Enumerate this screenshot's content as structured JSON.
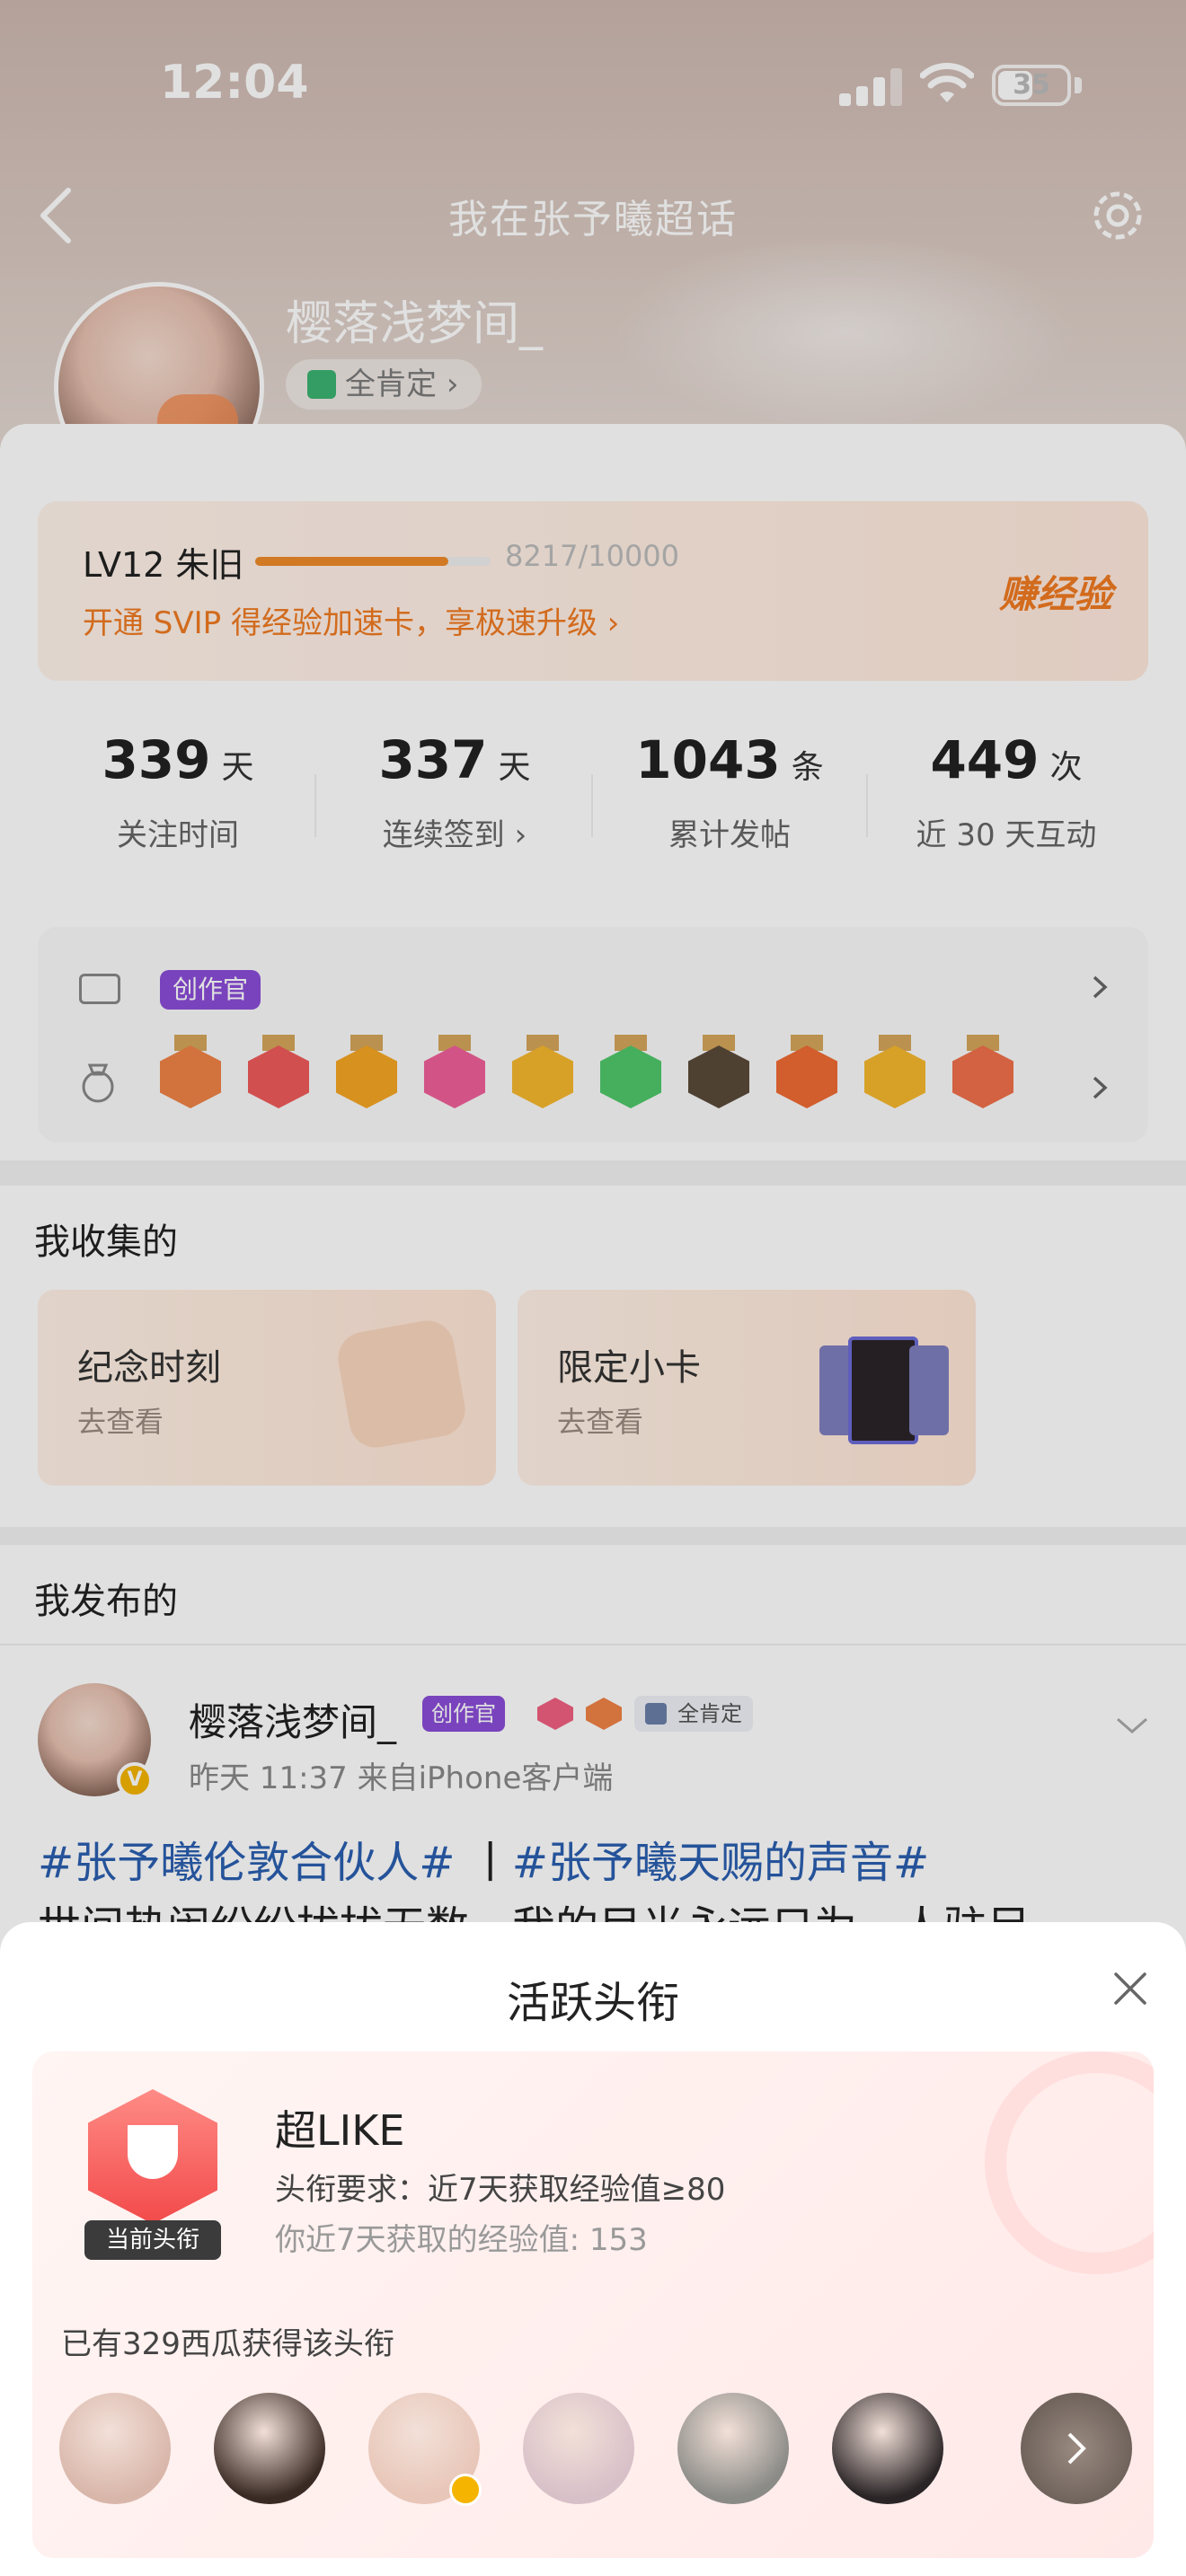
{
  "status_bar": {
    "time": "12:04",
    "battery": "35"
  },
  "nav": {
    "title": "我在张予曦超话"
  },
  "profile": {
    "username": "樱落浅梦间_",
    "approve_label": "全肯定",
    "approve_arrow": "›"
  },
  "level": {
    "name": "LV12 朱旧",
    "progress_text": "8217/10000",
    "progress_fraction": 0.8217,
    "promo": "开通 SVIP 得经验加速卡，享极速升级 ›",
    "earn_exp": "赚经验",
    "accent_color": "#f07a22"
  },
  "stats": [
    {
      "value": "339",
      "unit": "天",
      "label": "关注时间"
    },
    {
      "value": "337",
      "unit": "天",
      "label": "连续签到 ›"
    },
    {
      "value": "1043",
      "unit": "条",
      "label": "累计发帖"
    },
    {
      "value": "449",
      "unit": "次",
      "label": "近 30 天互动"
    }
  ],
  "badges": {
    "creator_label": "创作官",
    "medal_colors": [
      "#f08246",
      "#f05a5a",
      "#f5a623",
      "#f0609a",
      "#f5b82e",
      "#4fc86a",
      "#5a4a3a",
      "#f06a34",
      "#f5b82e",
      "#f0704a"
    ]
  },
  "collection": {
    "title": "我收集的",
    "cards": [
      {
        "title": "纪念时刻",
        "subtitle": "去查看"
      },
      {
        "title": "限定小卡",
        "subtitle": "去查看"
      }
    ]
  },
  "posts": {
    "title": "我发布的",
    "author": "樱落浅梦间_",
    "creator_tag": "创作官",
    "approve_tag": "全肯定",
    "meta": "昨天 11:37  来自iPhone客户端",
    "hashtag1": "#张予曦伦敦合伙人#",
    "separator": " 丨",
    "hashtag2": "#张予曦天赐的声音#",
    "line2": "世间热闹纷纷扰扰无数，我的目光永远只为一人驻足"
  },
  "sheet": {
    "title": "活跃头衔",
    "badge_label": "当前头衔",
    "title_name": "超LIKE",
    "requirement": "头衔要求：近7天获取经验值≥80",
    "my_value": "你近7天获取的经验值: 153",
    "holder_count": "已有329西瓜获得该头衔",
    "holder_colors": [
      "#d9b6aa",
      "#3a2a24",
      "#e8c6b8",
      "#d8c0c8",
      "#8a8a86",
      "#2a2426"
    ]
  }
}
